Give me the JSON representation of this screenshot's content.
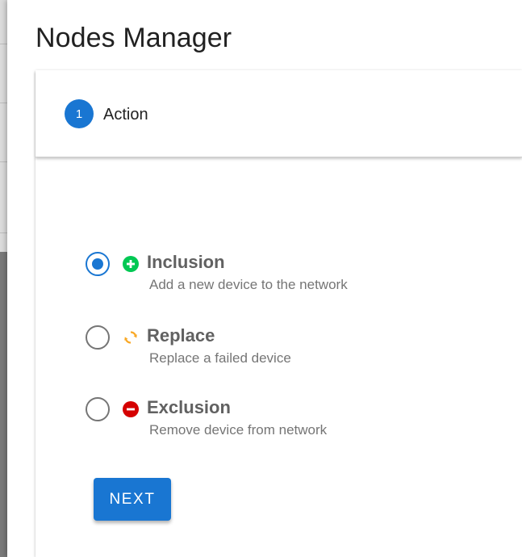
{
  "dialog": {
    "title": "Nodes Manager"
  },
  "stepper": {
    "steps": [
      {
        "number": "1",
        "label": "Action"
      }
    ]
  },
  "options": [
    {
      "title": "Inclusion",
      "description": "Add a new device to the network",
      "icon": "plus-circle-icon",
      "icon_color": "#00c853",
      "selected": true
    },
    {
      "title": "Replace",
      "description": "Replace a failed device",
      "icon": "refresh-icon",
      "icon_color": "#f9a825",
      "selected": false
    },
    {
      "title": "Exclusion",
      "description": "Remove device from network",
      "icon": "minus-circle-icon",
      "icon_color": "#d50000",
      "selected": false
    }
  ],
  "actions": {
    "next_label": "NEXT"
  },
  "colors": {
    "primary": "#1976d2"
  }
}
